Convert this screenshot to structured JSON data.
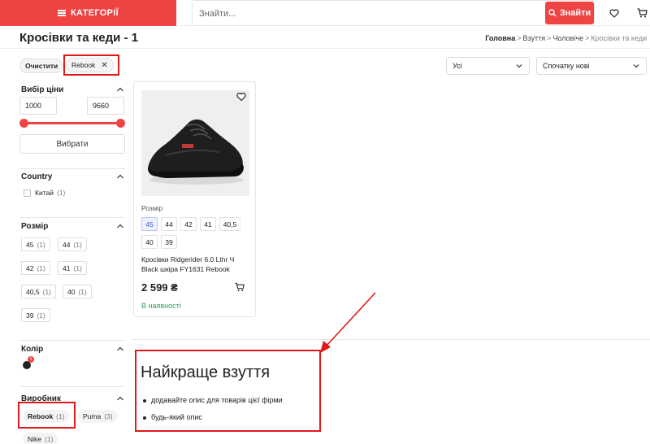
{
  "header": {
    "categories_label": "КАТЕГОРІЇ",
    "search_placeholder": "Знайти...",
    "search_button": "Знайти",
    "icons": [
      "menu-icon",
      "search-icon",
      "heart-icon",
      "cart-icon"
    ]
  },
  "page": {
    "title": "Кросівки та кеди - 1",
    "breadcrumb": [
      "Головна",
      "Взуття",
      "Чоловіче",
      "Кросівки та кеди"
    ]
  },
  "filters_active": {
    "clear_label": "Очистити",
    "chips": [
      {
        "label": "Rebook"
      }
    ]
  },
  "toolbar": {
    "filter_select": "Усі",
    "sort_select": "Спочатку нові"
  },
  "sidebar": {
    "price": {
      "title": "Вибір ціни",
      "min": "1000",
      "max": "9660",
      "apply": "Вибрати"
    },
    "country": {
      "title": "Country",
      "items": [
        {
          "label": "Китай",
          "count": "(1)"
        }
      ]
    },
    "size": {
      "title": "Розмір",
      "items": [
        {
          "label": "45",
          "count": "(1)"
        },
        {
          "label": "44",
          "count": "(1)"
        },
        {
          "label": "42",
          "count": "(1)"
        },
        {
          "label": "41",
          "count": "(1)"
        },
        {
          "label": "40,5",
          "count": "(1)"
        },
        {
          "label": "40",
          "count": "(1)"
        },
        {
          "label": "39",
          "count": "(1)"
        }
      ]
    },
    "color": {
      "title": "Колір",
      "badge": "1",
      "swatch_color": "#222222"
    },
    "brand": {
      "title": "Виробник",
      "items": [
        {
          "label": "Rebook",
          "count": "(1)"
        },
        {
          "label": "Puma",
          "count": "(3)"
        },
        {
          "label": "Nike",
          "count": "(1)"
        }
      ]
    }
  },
  "product": {
    "size_label": "Розмір",
    "sizes": [
      "45",
      "44",
      "42",
      "41",
      "40,5",
      "40",
      "39"
    ],
    "active_size": "45",
    "name": "Кросівки Ridgerider 6.0 Lthr Ч Black шкіра FY1631 Rebook",
    "price": "2 599 ₴",
    "stock": "В наявності"
  },
  "description": {
    "title": "Найкраще взуття",
    "items": [
      "додавайте опис для товарів цієї фірми",
      "будь-який опис"
    ]
  },
  "colors": {
    "accent": "#ef4444",
    "stock": "#2aa05f",
    "annotation": "#e01818"
  }
}
